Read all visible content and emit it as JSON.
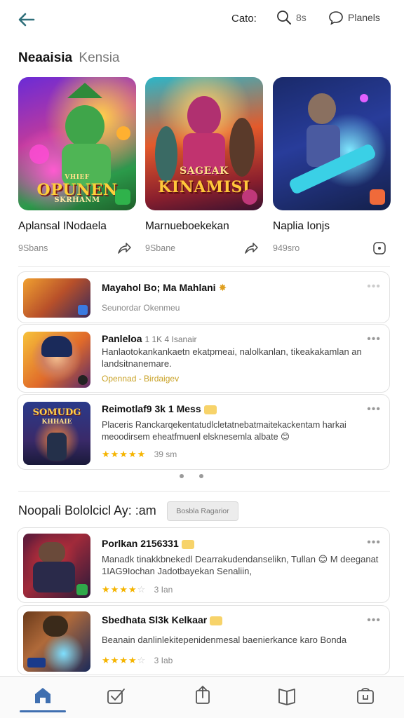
{
  "header": {
    "cats_label": "Cato:",
    "search_label": "8s",
    "panels_label": "Planels"
  },
  "section1": {
    "title": "Neaaisia",
    "subtitle": "Kensia"
  },
  "featured": [
    {
      "art_top": "VHIEF",
      "art_main": "OPUNEN",
      "art_sub": "SKRHANM",
      "title": "Aplansal INodaela",
      "meta": "9Sbans"
    },
    {
      "art_top": "SAGEAK",
      "art_main": "KINAMISI",
      "art_sub": "",
      "title": "Marnueboekekan",
      "meta": "9Sbane"
    },
    {
      "art_top": "",
      "art_main": "",
      "art_sub": "",
      "title": "Naplia Ionjs",
      "meta": "949sro"
    }
  ],
  "list": [
    {
      "title": "Mayahol Bo; Ma Mahlani",
      "desc": "",
      "meta": "Seunordar  Okenmeu",
      "stars": ""
    },
    {
      "title": "Panleloa",
      "title_extra": "1 1K 4 Isanair",
      "desc": "Hanlaotokankankaetn ekatpmeai, nalolkanlan, tikeakakamlan an landsitnanemare.",
      "meta": "Opennad -  Birdaigev",
      "stars": ""
    },
    {
      "title": "Reimotlaf9 3k 1 Mess",
      "thumb_top": "SOMUDG",
      "thumb_sub": "KHHAIE",
      "desc": "Placeris Ranckarqekentatudlcletatnebatmaitekackentam harkai meoodirsem eheatfmuenl elsknesemla albate 😊",
      "meta": "39 sm",
      "stars": "★★★★★"
    }
  ],
  "section2": {
    "title": "Noopali Bololcicl Ay: :am",
    "chip": "Bosbla Ragarior"
  },
  "list2": [
    {
      "title": "Porlkan 2156331",
      "desc": "Manadk tinakkbnekedl Dearrakudendanselikn, Tullan 😊 M deeganat 1IAG9Iochan Jadotbayekan Senaliin,",
      "meta": "3 Ian",
      "stars": "★★★★",
      "stars_off": "☆"
    },
    {
      "title": "Sbedhata Sl3k Kelkaar",
      "desc": "Beanain danlinlekitepenidenmesal baenierkance karo Bonda",
      "meta": "3 Iab",
      "stars": "★★★★",
      "stars_off": "☆"
    }
  ],
  "colors": {
    "accent": "#3f6fb0",
    "star": "#f5b400",
    "back_arrow": "#2f6f7a"
  },
  "nav": [
    "home-icon",
    "check-icon",
    "share-icon",
    "book-icon",
    "bag-icon"
  ]
}
